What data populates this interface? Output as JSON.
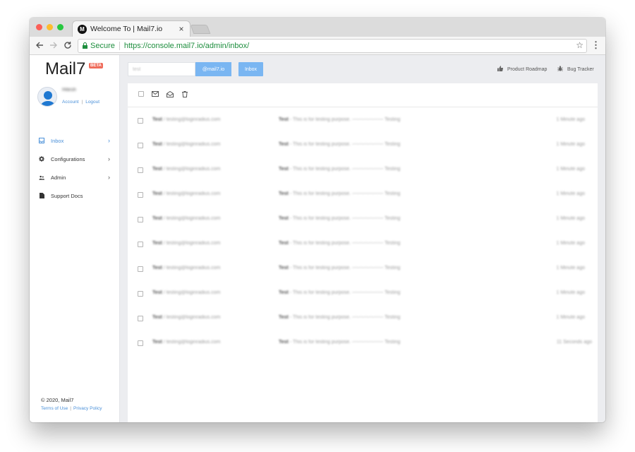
{
  "browser": {
    "tab_title": "Welcome To | Mail7.io",
    "favicon_letter": "M",
    "secure_label": "Secure",
    "url": "https://console.mail7.io/admin/inbox/"
  },
  "sidebar": {
    "logo": "Mail7",
    "beta_badge": "BETA",
    "user_name": "Hitesh",
    "account_link": "Account",
    "logout_link": "Logout",
    "items": [
      {
        "label": "Inbox",
        "icon": "inbox-icon",
        "active": true,
        "has_submenu": true
      },
      {
        "label": "Configurations",
        "icon": "gear-icon",
        "active": false,
        "has_submenu": true
      },
      {
        "label": "Admin",
        "icon": "users-icon",
        "active": false,
        "has_submenu": true
      },
      {
        "label": "Support Docs",
        "icon": "document-icon",
        "active": false,
        "has_submenu": false
      }
    ],
    "copyright": "© 2020, Mail7",
    "terms_link": "Terms of Use",
    "privacy_link": "Privacy Policy"
  },
  "topbar": {
    "search_value": "test",
    "domain_label": "@mail7.io",
    "inbox_button": "Inbox",
    "roadmap_link": "Product Roadmap",
    "bugtracker_link": "Bug Tracker"
  },
  "mail": {
    "rows": [
      {
        "from_name": "Test",
        "from_email": "/ testing@loginradius.com",
        "subject": "Test",
        "preview": "- This is for testing purpose. ------------------- Testing",
        "time": "1 Minute ago"
      },
      {
        "from_name": "Test",
        "from_email": "/ testing@loginradius.com",
        "subject": "Test",
        "preview": "- This is for testing purpose. ------------------- Testing",
        "time": "1 Minute ago"
      },
      {
        "from_name": "Test",
        "from_email": "/ testing@loginradius.com",
        "subject": "Test",
        "preview": "- This is for testing purpose. ------------------- Testing",
        "time": "1 Minute ago"
      },
      {
        "from_name": "Test",
        "from_email": "/ testing@loginradius.com",
        "subject": "Test",
        "preview": "- This is for testing purpose. ------------------- Testing",
        "time": "1 Minute ago"
      },
      {
        "from_name": "Test",
        "from_email": "/ testing@loginradius.com",
        "subject": "Test",
        "preview": "- This is for testing purpose. ------------------- Testing",
        "time": "1 Minute ago"
      },
      {
        "from_name": "Test",
        "from_email": "/ testing@loginradius.com",
        "subject": "Test",
        "preview": "- This is for testing purpose. ------------------- Testing",
        "time": "1 Minute ago"
      },
      {
        "from_name": "Test",
        "from_email": "/ testing@loginradius.com",
        "subject": "Test",
        "preview": "- This is for testing purpose. ------------------- Testing",
        "time": "1 Minute ago"
      },
      {
        "from_name": "Test",
        "from_email": "/ testing@loginradius.com",
        "subject": "Test",
        "preview": "- This is for testing purpose. ------------------- Testing",
        "time": "1 Minute ago"
      },
      {
        "from_name": "Test",
        "from_email": "/ testing@loginradius.com",
        "subject": "Test",
        "preview": "- This is for testing purpose. ------------------- Testing",
        "time": "1 Minute ago"
      },
      {
        "from_name": "Test",
        "from_email": "/ testing@loginradius.com",
        "subject": "Test",
        "preview": "- This is for testing purpose. ------------------- Testing",
        "time": "11 Seconds ago"
      }
    ]
  },
  "colors": {
    "accent": "#4a90d9",
    "button_blue": "#7ab6f2",
    "beta_badge": "#ef6c5b",
    "secure_green": "#1e8e3e",
    "content_bg": "#ecedf0"
  }
}
